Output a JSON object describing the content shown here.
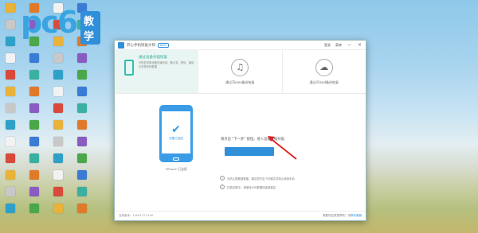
{
  "brand": {
    "logo_text": "pc6",
    "tag": "教学"
  },
  "window": {
    "title": "开心手机恢复大师",
    "version_badge": "beta",
    "menu": [
      "登录",
      "菜单"
    ],
    "controls": [
      "minimize-icon",
      "close-icon"
    ],
    "tabs": [
      {
        "title": "通过设备扫描恢复",
        "desc": "可恢复苹果设备的通讯录、备忘录、短信、通话记录等多种数据"
      },
      {
        "title": "通过iTunes备份恢复",
        "icon": "music-note-icon"
      },
      {
        "title": "通过iCloud备份恢复",
        "icon": "cloud-icon"
      }
    ],
    "phone_status": "设备已连接",
    "phone_caption": "\"iPhone\"已连接",
    "prompt": "请点击 \"下一步\" 按钮，进入设备数据扫描",
    "notes": [
      "为防止数据被覆盖，建议您开启飞行模式并停止使用手机",
      "扫描过程中，请保持USB数据线连接稳定"
    ],
    "footer": {
      "version": "当前版本：1.6.6177.1140",
      "help_prefix": "需要恢复数据帮助？请",
      "help_link": "联系客服"
    }
  },
  "colors": {
    "accent": "#2f8fd9",
    "teal": "#2fbfb0",
    "arrow": "#e02020"
  }
}
